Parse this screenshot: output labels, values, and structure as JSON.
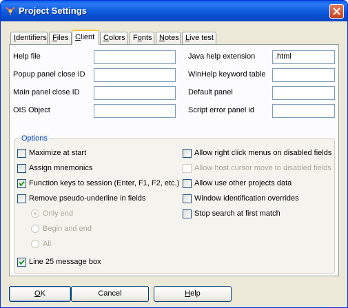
{
  "window": {
    "title": "Project Settings"
  },
  "tabs": [
    {
      "label": "Identifiers",
      "accel": "I",
      "rest": "dentifiers",
      "pre": ""
    },
    {
      "label": "Files",
      "pre": "",
      "accel": "F",
      "rest": "iles"
    },
    {
      "label": "Client",
      "pre": "",
      "accel": "C",
      "rest": "lient"
    },
    {
      "label": "Colors",
      "pre": "",
      "accel": "C",
      "rest": "olors"
    },
    {
      "label": "Fonts",
      "pre": "F",
      "accel": "o",
      "rest": "nts"
    },
    {
      "label": "Notes",
      "pre": "",
      "accel": "N",
      "rest": "otes"
    },
    {
      "label": "Live test",
      "pre": "",
      "accel": "L",
      "rest": "ive test"
    }
  ],
  "active_tab": "Client",
  "fields": {
    "help_file": {
      "label": "Help file",
      "value": ""
    },
    "popup_panel_close_id": {
      "label": "Popup panel close ID",
      "value": ""
    },
    "main_panel_close_id": {
      "label": "Main panel close ID",
      "value": ""
    },
    "ois_object": {
      "label": "OIS Object",
      "value": ""
    },
    "java_help_extension": {
      "label": "Java help extension",
      "value": ".html"
    },
    "winhelp_keyword_table": {
      "label": "WinHelp keyword table",
      "value": ""
    },
    "default_panel": {
      "label": "Default panel",
      "value": ""
    },
    "script_error_panel_id": {
      "label": "Script error panel id",
      "value": ""
    }
  },
  "options": {
    "legend": "Options",
    "maximize_at_start": {
      "label": "Maximize at start",
      "checked": false
    },
    "assign_mnemonics": {
      "label": "Assign mnemonics",
      "checked": false
    },
    "function_keys_to_session": {
      "label": "Function keys to session (Enter, F1, F2, etc.)",
      "checked": true
    },
    "remove_pseudo_underline": {
      "label": "Remove pseudo-underline in fields",
      "checked": false
    },
    "radio_only_end": {
      "label": "Only end",
      "selected": true,
      "enabled": false
    },
    "radio_begin_and_end": {
      "label": "Begin and end",
      "selected": false,
      "enabled": false
    },
    "radio_all": {
      "label": "All",
      "selected": false,
      "enabled": false
    },
    "line_25_message_box": {
      "label": "Line 25 message box",
      "checked": true
    },
    "allow_right_click_menus": {
      "label": "Allow right click menus on disabled fields",
      "checked": false
    },
    "allow_host_cursor_move": {
      "label": "Allow host cursor move to disabled fields",
      "checked": false,
      "enabled": false
    },
    "allow_use_other_projects_data": {
      "label": "Allow use other projects data",
      "checked": false
    },
    "window_identification_overrides": {
      "label": "Window identification overrides",
      "checked": false
    },
    "stop_search_at_first_match": {
      "label": "Stop search at first match",
      "checked": false
    }
  },
  "buttons": {
    "ok": {
      "label": "OK",
      "pre": "",
      "accel": "O",
      "rest": "K"
    },
    "cancel": {
      "label": "Cancel",
      "text": "Cancel"
    },
    "help": {
      "label": "Help",
      "pre": "",
      "accel": "H",
      "rest": "elp"
    }
  },
  "colors": {
    "titlebar": "#0a56d8",
    "accent_tab": "#ffc83c",
    "group_legend": "#0046d5",
    "close_button": "#c8411b"
  }
}
